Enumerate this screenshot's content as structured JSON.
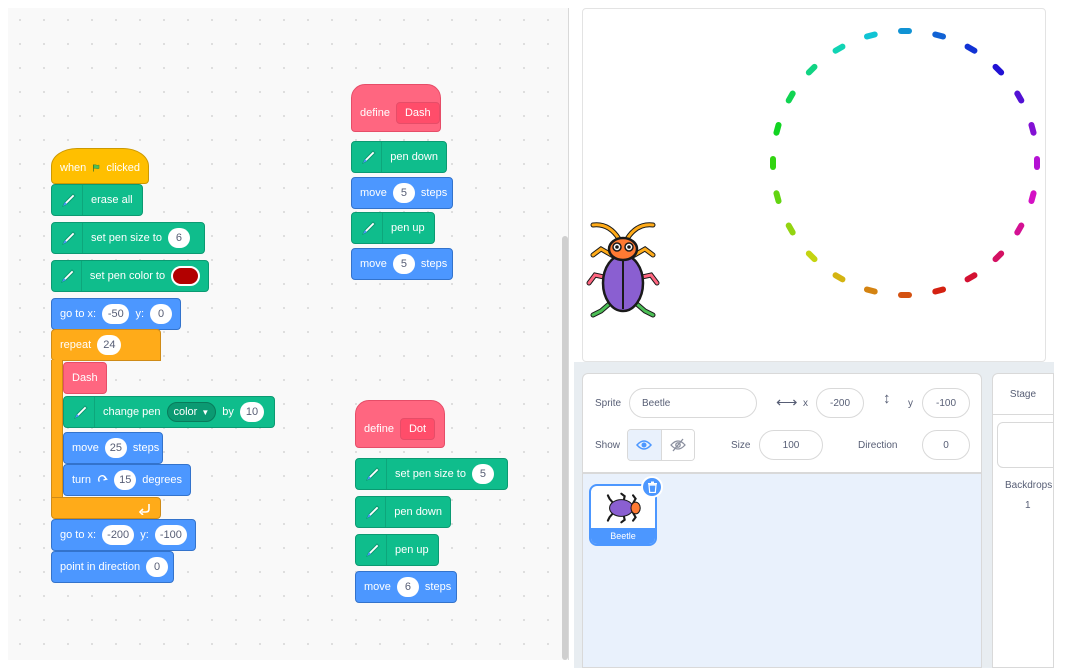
{
  "scripts": {
    "main": {
      "hat_when": "when",
      "hat_clicked": "clicked",
      "erase_all": "erase all",
      "set_pen_size_label": "set pen size to",
      "set_pen_size_value": "6",
      "set_pen_color_label": "set pen color to",
      "set_pen_color_value": "#b20000",
      "goto_label": "go to x:",
      "goto_x": "-50",
      "goto_y_label": "y:",
      "goto_y": "0",
      "repeat_label": "repeat",
      "repeat_count": "24",
      "dash_call": "Dash",
      "change_pen_label": "change pen",
      "change_pen_param": "color",
      "change_pen_by": "by",
      "change_pen_value": "10",
      "move_label": "move",
      "move_value": "25",
      "steps_label": "steps",
      "turn_label": "turn",
      "turn_value": "15",
      "degrees_label": "degrees",
      "goto2_label": "go to x:",
      "goto2_x": "-200",
      "goto2_y_label": "y:",
      "goto2_y": "-100",
      "point_dir_label": "point in direction",
      "point_dir_value": "0"
    },
    "dash": {
      "define_label": "define",
      "name": "Dash",
      "pen_down": "pen down",
      "move1_label": "move",
      "move1_value": "5",
      "move1_steps": "steps",
      "pen_up": "pen up",
      "move2_label": "move",
      "move2_value": "5",
      "move2_steps": "steps"
    },
    "dot": {
      "define_label": "define",
      "name": "Dot",
      "set_pen_size_label": "set pen size to",
      "set_pen_size_value": "5",
      "pen_down": "pen down",
      "pen_up": "pen up",
      "move_label": "move",
      "move_value": "6",
      "move_steps": "steps"
    }
  },
  "sprite_info": {
    "sprite_label": "Sprite",
    "sprite_name": "Beetle",
    "x_label": "x",
    "x_value": "-200",
    "y_label": "y",
    "y_value": "-100",
    "show_label": "Show",
    "size_label": "Size",
    "size_value": "100",
    "direction_label": "Direction",
    "direction_value": "0"
  },
  "sprite_list": {
    "items": [
      {
        "name": "Beetle"
      }
    ]
  },
  "stage_panel": {
    "title": "Stage",
    "backdrops_label": "Backdrops",
    "backdrops_count": "1"
  },
  "colors": {
    "pen": "#0fbd8c",
    "motion": "#4c97ff",
    "events": "#ffbf00",
    "control": "#ffab19",
    "my_blocks": "#ff6680",
    "pen_color_swatch": "#b20000"
  }
}
